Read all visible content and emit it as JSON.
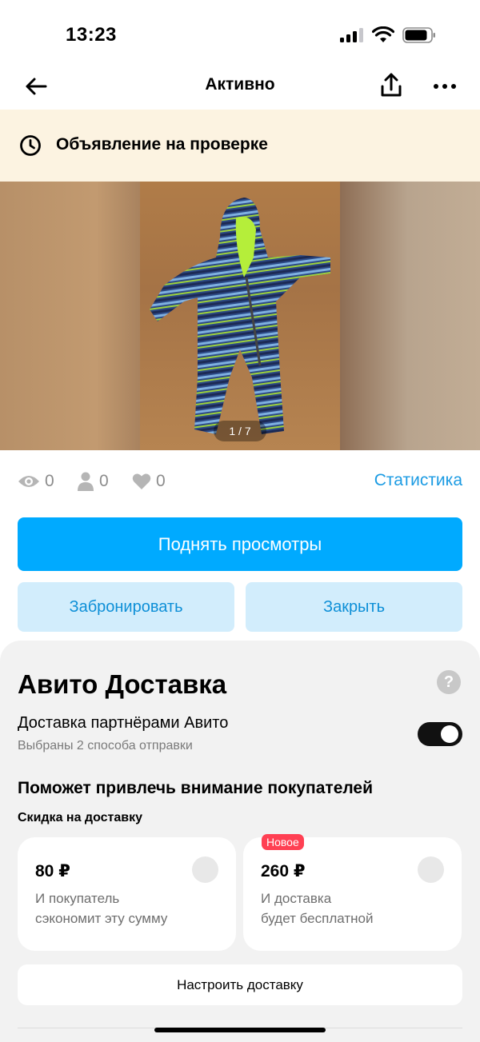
{
  "status_bar": {
    "time": "13:23",
    "icons": [
      "cellular-signal-icon",
      "wifi-icon",
      "battery-icon"
    ]
  },
  "nav": {
    "title": "Активно",
    "icons": [
      "arrow-left-icon",
      "share-icon",
      "more-dots-icon"
    ]
  },
  "banner": {
    "text": "Объявление на проверке",
    "icon": "clock-icon",
    "background": "#fcf3e1"
  },
  "photo": {
    "counter": "1 / 7",
    "subject": "striped winter jumpsuit photo"
  },
  "stats": {
    "views": "0",
    "contacts": "0",
    "favorites": "0",
    "statistics_link": "Статистика",
    "icons": [
      "eye-icon",
      "person-icon",
      "heart-icon"
    ]
  },
  "actions": {
    "boost": "Поднять просмотры",
    "book": "Забронировать",
    "close": "Закрыть",
    "primary_color": "#00aaff",
    "secondary_bg": "#d2edfc",
    "secondary_text_color": "#0d8fd7"
  },
  "delivery": {
    "title": "Авито Доставка",
    "help_icon": "?",
    "partner_label": "Доставка партнёрами Авито",
    "partner_sub": "Выбраны 2 способа отправки",
    "toggle_on": true,
    "attract_title": "Поможет привлечь внимание покупателей",
    "discount_label": "Скидка на доставку",
    "options": [
      {
        "amount": "80 ₽",
        "desc_line1": "И покупатель",
        "desc_line2": "сэкономит эту сумму",
        "badge": ""
      },
      {
        "amount": "260 ₽",
        "desc_line1": "И доставка",
        "desc_line2": "будет бесплатной",
        "badge": "Новое"
      }
    ],
    "setup_button": "Настроить доставку"
  }
}
